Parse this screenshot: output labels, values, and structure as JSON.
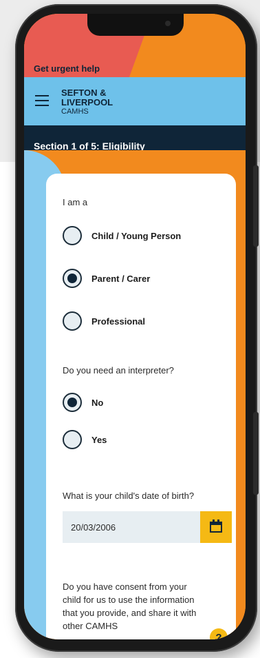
{
  "urgent": {
    "label": "Get urgent help"
  },
  "header": {
    "logo_line1": "SEFTON &",
    "logo_line2": "LIVERPOOL",
    "logo_line3": "CAMHS"
  },
  "section": {
    "title": "Section 1 of 5: Eligibility"
  },
  "form": {
    "q_role": {
      "label": "I am a",
      "options": [
        {
          "label": "Child / Young Person",
          "selected": false
        },
        {
          "label": "Parent / Carer",
          "selected": true
        },
        {
          "label": "Professional",
          "selected": false
        }
      ]
    },
    "q_interpreter": {
      "label": "Do you need an interpreter?",
      "options": [
        {
          "label": "No",
          "selected": true
        },
        {
          "label": "Yes",
          "selected": false
        }
      ]
    },
    "q_dob": {
      "label": "What is your child's date of birth?",
      "value": "20/03/2006"
    },
    "q_consent": {
      "label": "Do you have consent from your child for us to use the information that you provide, and share it with other CAMHS",
      "help_label": "?"
    }
  },
  "colors": {
    "navy": "#0f2538",
    "orange": "#f28a1e",
    "red": "#e85b52",
    "light_blue": "#6ec1ea",
    "yellow": "#f5b914"
  }
}
